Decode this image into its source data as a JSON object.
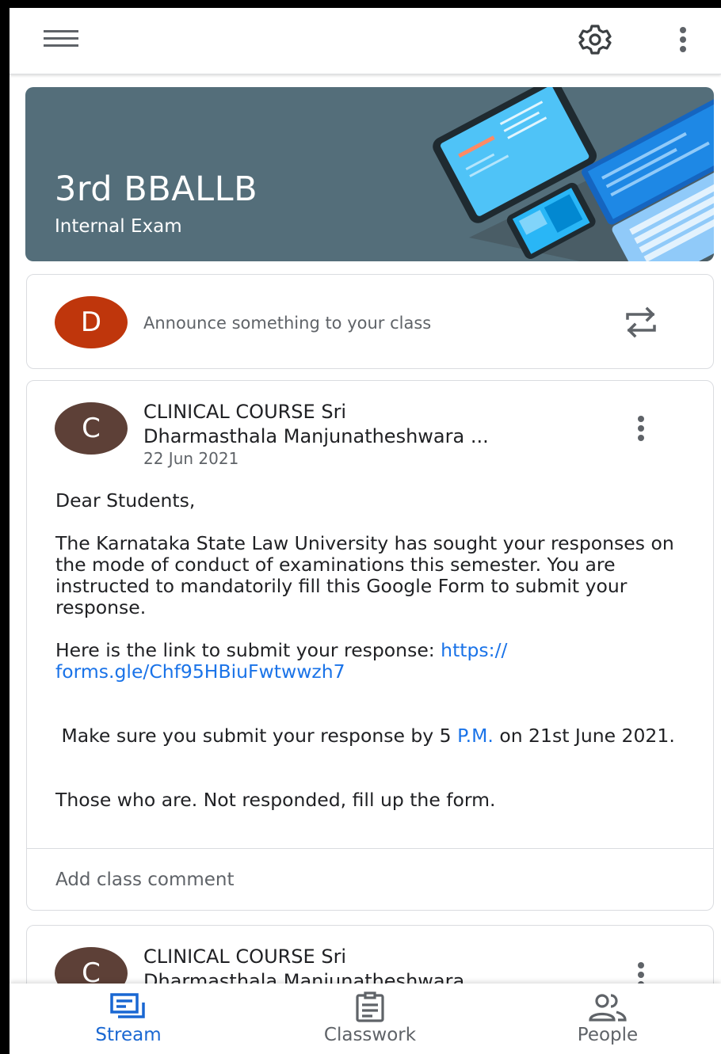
{
  "topbar": {
    "menu_icon": "hamburger-menu-icon",
    "settings_icon": "gear-icon",
    "more_icon": "more-vert-icon"
  },
  "banner": {
    "title": "3rd BBALLB",
    "subtitle": "Internal Exam"
  },
  "announce": {
    "avatar_letter": "D",
    "placeholder": "Announce something to your class",
    "repost_icon": "repost-icon"
  },
  "posts": [
    {
      "avatar_letter": "C",
      "author_line1": "CLINICAL COURSE Sri",
      "author_line2": "Dharmasthala Manjunatheshwara ...",
      "date": "22 Jun 2021",
      "greeting": "Dear Students,",
      "paragraph1": "The Karnataka State Law University has sought your responses on the mode of conduct of examinations this semester. You are instructed to mandatorily fill this Google Form to submit your response.",
      "link_intro": "Here is the link to submit your response: ",
      "link_text_1": "https://",
      "link_text_2": "forms.gle/Chf95HBiuFwtwwzh7",
      "deadline_pre": " Make sure you submit your response by 5 ",
      "deadline_link": "P.M.",
      "deadline_post": " on 21st June 2021.",
      "closing": "Those who are. Not responded, fill up the form.",
      "comment_label": "Add class comment"
    },
    {
      "avatar_letter": "C",
      "author_line1": "CLINICAL COURSE Sri",
      "author_line2": "Dharmasthala Manjunatheshwara ..."
    }
  ],
  "bottom_nav": {
    "stream": "Stream",
    "classwork": "Classwork",
    "people": "People"
  },
  "colors": {
    "accent": "#1967d2",
    "banner_bg": "#546e7a",
    "avatar_d": "#bf360c",
    "avatar_c": "#5d4037"
  }
}
